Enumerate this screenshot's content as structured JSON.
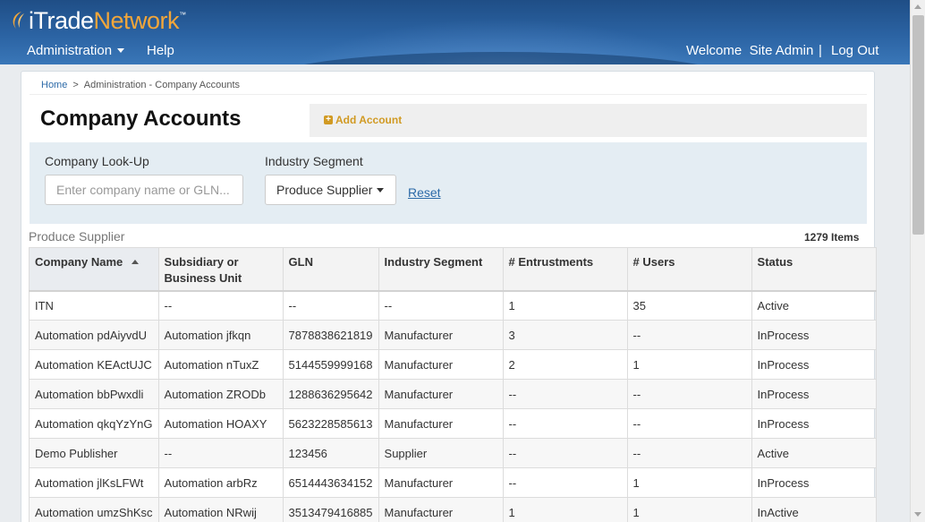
{
  "header": {
    "logo_a": "iTrade",
    "logo_b": "Network",
    "logo_tm": "™",
    "nav_admin": "Administration",
    "nav_help": "Help",
    "welcome": "Welcome  Site Admin",
    "separator": "|",
    "logout": "Log Out"
  },
  "breadcrumb": {
    "home": "Home",
    "sep": ">",
    "current": "Administration - Company Accounts"
  },
  "page": {
    "title": "Company Accounts",
    "add_label": "Add Account"
  },
  "filters": {
    "company_label": "Company Look-Up",
    "company_placeholder": "Enter company name or GLN...",
    "company_value": "",
    "industry_label": "Industry Segment",
    "industry_selected": "Produce Supplier",
    "reset_label": "Reset"
  },
  "results": {
    "segment_caption": "Produce Supplier",
    "count": "1279 Items"
  },
  "table": {
    "headers": {
      "company": "Company Name",
      "subsidiary_line1": "Subsidiary or",
      "subsidiary_line2": "Business Unit",
      "gln": "GLN",
      "industry": "Industry Segment",
      "entrustments": "# Entrustments",
      "users": "# Users",
      "status": "Status"
    },
    "rows": [
      {
        "company": "ITN",
        "subsidiary": "--",
        "gln": "--",
        "industry": "--",
        "entrustments": "1",
        "users": "35",
        "status": "Active"
      },
      {
        "company": "Automation pdAiyvdU",
        "subsidiary": "Automation jfkqn",
        "gln": "7878838621819",
        "industry": "Manufacturer",
        "entrustments": "3",
        "users": "--",
        "status": "InProcess"
      },
      {
        "company": "Automation KEActUJC",
        "subsidiary": "Automation nTuxZ",
        "gln": "5144559999168",
        "industry": "Manufacturer",
        "entrustments": "2",
        "users": "1",
        "status": "InProcess"
      },
      {
        "company": "Automation bbPwxdli",
        "subsidiary": "Automation ZRODb",
        "gln": "1288636295642",
        "industry": "Manufacturer",
        "entrustments": "--",
        "users": "--",
        "status": "InProcess"
      },
      {
        "company": "Automation qkqYzYnG",
        "subsidiary": "Automation HOAXY",
        "gln": "5623228585613",
        "industry": "Manufacturer",
        "entrustments": "--",
        "users": "--",
        "status": "InProcess"
      },
      {
        "company": "Demo Publisher",
        "subsidiary": "--",
        "gln": "123456",
        "industry": "Supplier",
        "entrustments": "--",
        "users": "--",
        "status": "Active"
      },
      {
        "company": "Automation jlKsLFWt",
        "subsidiary": "Automation arbRz",
        "gln": "6514443634152",
        "industry": "Manufacturer",
        "entrustments": "--",
        "users": "1",
        "status": "InProcess"
      },
      {
        "company": "Automation umzShKsc",
        "subsidiary": "Automation NRwij",
        "gln": "3513479416885",
        "industry": "Manufacturer",
        "entrustments": "1",
        "users": "1",
        "status": "InActive"
      }
    ]
  },
  "colors": {
    "header_blue": "#2b63a3",
    "accent_gold": "#d19a23",
    "link_blue": "#2c6aa8"
  }
}
